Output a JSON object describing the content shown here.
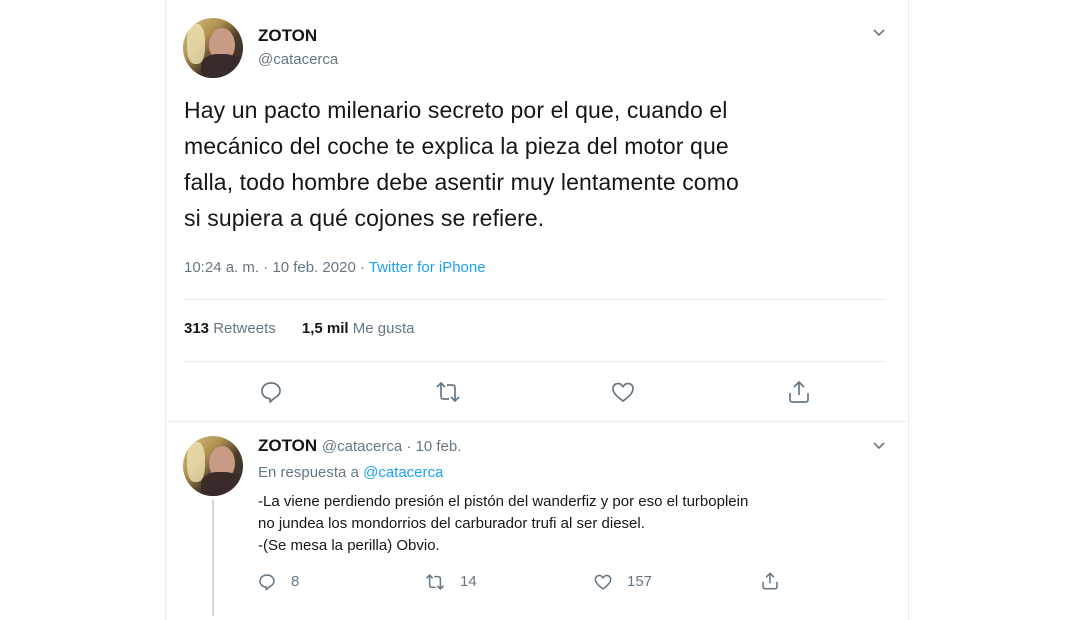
{
  "tweet": {
    "name": "ZOTON",
    "handle": "@catacerca",
    "text_lines": [
      "Hay un pacto milenario secreto por el que, cuando el",
      "mecánico del coche te explica la pieza del motor que",
      "falla, todo hombre debe asentir muy lentamente como",
      "si supiera a qué cojones se refiere."
    ],
    "time": "10:24 a. m. · 10 feb. 2020 · ",
    "source": "Twitter for iPhone",
    "retweets_count": "313",
    "retweets_label": "Retweets",
    "likes_count": "1,5 mil",
    "likes_label": "Me gusta"
  },
  "reply": {
    "name": "ZOTON",
    "handle_date": "@catacerca · 10 feb.",
    "in_reply_prefix": "En respuesta a ",
    "in_reply_mention": "@catacerca",
    "text_lines": [
      "-La viene perdiendo presión el pistón del wanderfiz y por eso el turboplein",
      "no jundea los mondorrios del carburador trufi al ser diesel.",
      "-(Se mesa la perilla) Obvio."
    ],
    "reply_count": "8",
    "retweet_count": "14",
    "like_count": "157"
  },
  "icons": {
    "reply": "reply-icon",
    "retweet": "retweet-icon",
    "like": "heart-icon",
    "share": "share-icon",
    "caret": "chevron-down-icon"
  },
  "colors": {
    "accent": "#1da1f2",
    "secondary_text": "#657786",
    "divider": "#e6ecf0"
  }
}
